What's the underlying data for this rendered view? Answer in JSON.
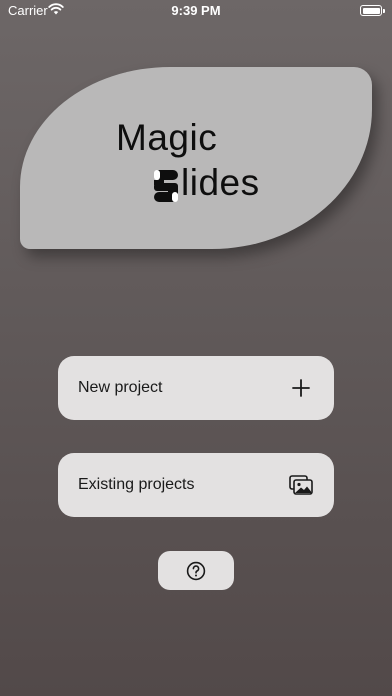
{
  "status_bar": {
    "carrier": "Carrier",
    "time": "9:39 PM"
  },
  "logo": {
    "line1": "Magic",
    "line2_rest": "lides",
    "card_color": "#b9b8b8"
  },
  "menu": {
    "new_project_label": "New project",
    "new_project_icon": "plus-icon",
    "existing_projects_label": "Existing projects",
    "existing_projects_icon": "photo-stack-icon",
    "help_icon": "question-circle-icon"
  },
  "colors": {
    "background_top": "#6d6767",
    "background_bottom": "#524949",
    "button_bg": "#e3e1e1",
    "text": "#1a1a1a"
  }
}
